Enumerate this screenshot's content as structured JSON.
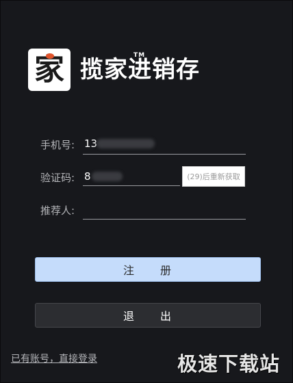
{
  "logo": {
    "icon_char": "家",
    "text": "揽家进销存",
    "tm": "TM"
  },
  "form": {
    "phone": {
      "label": "手机号:",
      "value": "13"
    },
    "code": {
      "label": "验证码:",
      "value": "8"
    },
    "referrer": {
      "label": "推荐人:",
      "value": ""
    },
    "resend_label": "(29)后重新获取"
  },
  "buttons": {
    "register": "注　　册",
    "exit": "退　　出"
  },
  "login_link": "已有账号，直接登录",
  "watermark": "极速下载站",
  "colors": {
    "background": "#17181c",
    "register_button": "#c5dcfb",
    "exit_button": "#2c2d31",
    "logo_accent": "#e0542c"
  }
}
